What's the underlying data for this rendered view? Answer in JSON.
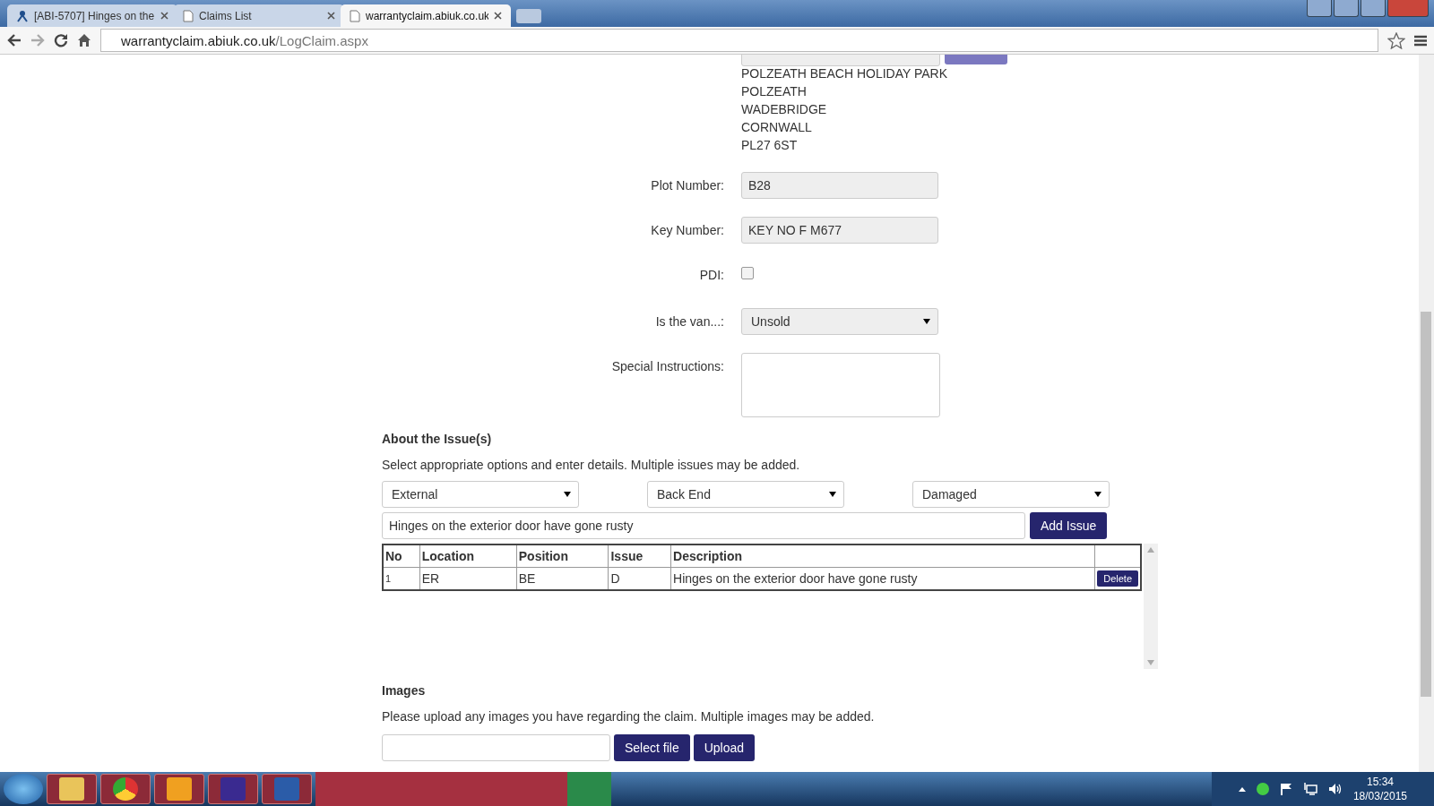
{
  "browser": {
    "tabs": [
      {
        "label": "[ABI-5707] Hinges on the",
        "selected": false
      },
      {
        "label": "Claims List",
        "selected": false
      },
      {
        "label": "warrantyclaim.abiuk.co.uk",
        "selected": true
      }
    ],
    "url_host": "warrantyclaim.abiuk.co.uk",
    "url_path": "/LogClaim.aspx"
  },
  "site": {
    "address_lines": [
      "POLZEATH BEACH HOLIDAY PARK",
      "POLZEATH",
      "WADEBRIDGE",
      "CORNWALL",
      "PL27 6ST"
    ]
  },
  "form": [
    {
      "kind": "text",
      "label": "Plot Number:",
      "value": "B28"
    },
    {
      "kind": "text",
      "label": "Key Number:",
      "value": "KEY NO F M677"
    },
    {
      "kind": "checkbox",
      "label": "PDI:",
      "checked": false
    },
    {
      "kind": "select",
      "label": "Is the van...:",
      "value": "Unsold"
    },
    {
      "kind": "textarea",
      "label": "Special Instructions:"
    }
  ],
  "issues": {
    "heading": "About the Issue(s)",
    "description": "Select appropriate options and enter details. Multiple issues may be added.",
    "selects": [
      "External",
      "Back End",
      "Damaged"
    ],
    "description_value": "Hinges on the exterior door have gone rusty",
    "add_button": "Add Issue",
    "columns": [
      "No",
      "Location",
      "Position",
      "Issue",
      "Description"
    ],
    "rows": [
      {
        "cells": [
          "1",
          "ER",
          "BE",
          "D",
          "Hinges on the exterior door have gone rusty"
        ],
        "action": "Delete"
      }
    ]
  },
  "images": {
    "heading": "Images",
    "description": "Please upload any images you have regarding the claim. Multiple images may be added.",
    "select_button": "Select file",
    "upload_button": "Upload"
  },
  "taskbar": {
    "time": "15:34",
    "date": "18/03/2015"
  }
}
